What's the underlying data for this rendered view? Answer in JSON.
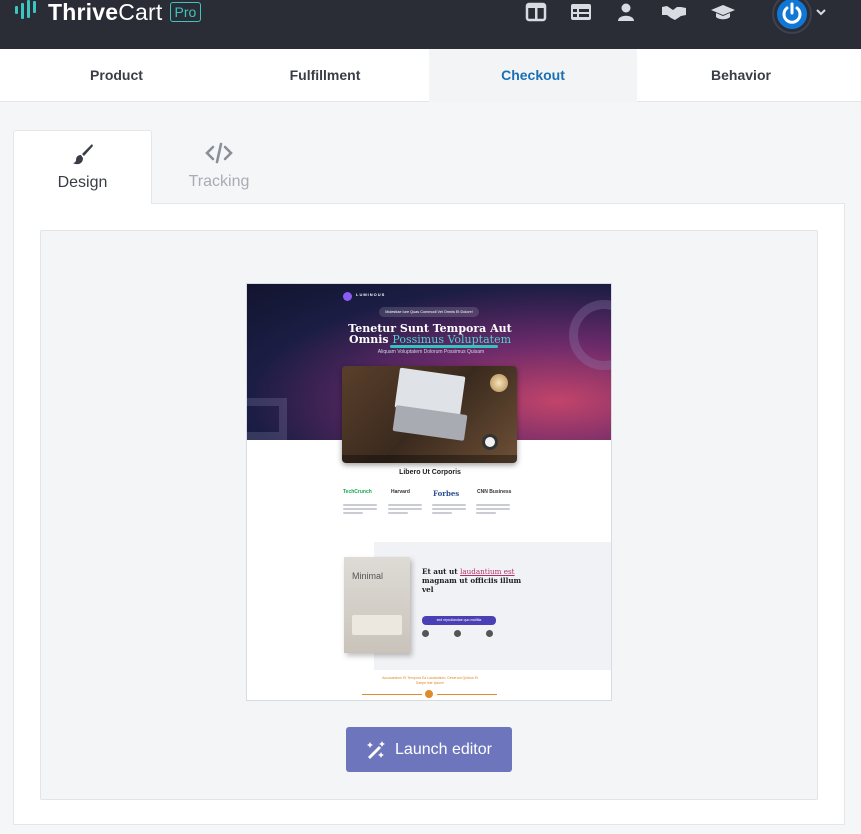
{
  "brand": {
    "name_bold": "Thrive",
    "name_regular": "Cart",
    "badge": "Pro",
    "accent": "#3cc5c1"
  },
  "topbar": {
    "icons": [
      "columns-icon",
      "table-icon",
      "user-icon",
      "handshake-icon",
      "graduation-cap-icon"
    ],
    "avatar_icon": "power-icon"
  },
  "main_tabs": [
    {
      "label": "Product",
      "active": false
    },
    {
      "label": "Fulfillment",
      "active": false
    },
    {
      "label": "Checkout",
      "active": true
    },
    {
      "label": "Behavior",
      "active": false
    }
  ],
  "sub_tabs": [
    {
      "label": "Design",
      "icon": "paint-brush-icon",
      "active": true
    },
    {
      "label": "Tracking",
      "icon": "code-icon",
      "active": false
    }
  ],
  "preview": {
    "logo_text": "LUMINOUS",
    "pill_text": "Molestiae Iure Quas Commodi Vel Omnis Et Dolore!",
    "headline_1": "Tenetur Sunt Tempora Aut",
    "headline_2": "Omnis",
    "headline_highlight": "Possimus Voluptatem",
    "subheadline": "Aliquam Voluptatem Dolorum Possimus Quisam",
    "section_title": "Libero Ut Corporis",
    "press_logos": [
      "TechCrunch",
      "Harvard",
      "Forbes",
      "CNN Business"
    ],
    "book_title": "Minimal",
    "feature_headline_1": "Et aut ut",
    "feature_headline_highlight": "laudantium est",
    "feature_headline_2": "magnam ut officiis illum vel",
    "feature_button": "sed repudiandae quo mollitia",
    "footer_text": "Accusantium Et Tempora Ea Laudantium, Deserunt Quibus Et Saepe Iste Ipsum!"
  },
  "actions": {
    "launch_label": "Launch editor",
    "launch_color": "#6d76bd"
  },
  "colors": {
    "topbar_bg": "#2b2d36",
    "active_tab_text": "#1a6fb5"
  }
}
